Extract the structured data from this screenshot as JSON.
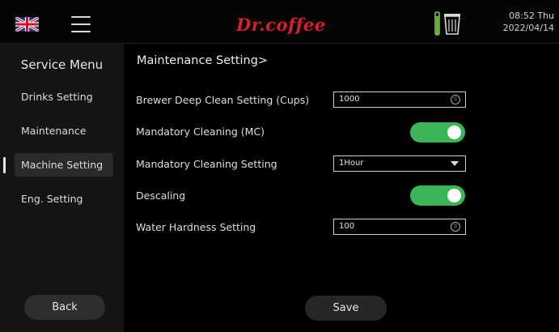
{
  "header": {
    "brand": "Dr.coffee",
    "time": "08:52 Thu",
    "date": "2022/04/14",
    "icons": [
      "uk-flag-icon",
      "hamburger-menu-icon",
      "water-level-icon",
      "waste-bin-icon"
    ]
  },
  "sidebar": {
    "title": "Service Menu",
    "items": [
      {
        "label": "Drinks Setting"
      },
      {
        "label": "Maintenance"
      },
      {
        "label": "Machine Setting",
        "active": true
      },
      {
        "label": "Eng. Setting"
      }
    ],
    "back_label": "Back"
  },
  "main": {
    "section_title": "Maintenance Setting>",
    "rows": [
      {
        "label": "Brewer Deep Clean Setting (Cups)",
        "value": "1000"
      },
      {
        "label": "Mandatory Cleaning (MC)",
        "toggle": "on"
      },
      {
        "label": "Mandatory Cleaning Setting",
        "value": "1Hour"
      },
      {
        "label": "Descaling",
        "toggle": "on"
      },
      {
        "label": "Water Hardness Setting",
        "value": "100"
      }
    ],
    "save_label": "Save"
  },
  "colors": {
    "brand_red": "#d8202a",
    "toggle_green": "#3cb55a",
    "sidebar_bg": "#141414",
    "background": "#000000"
  }
}
